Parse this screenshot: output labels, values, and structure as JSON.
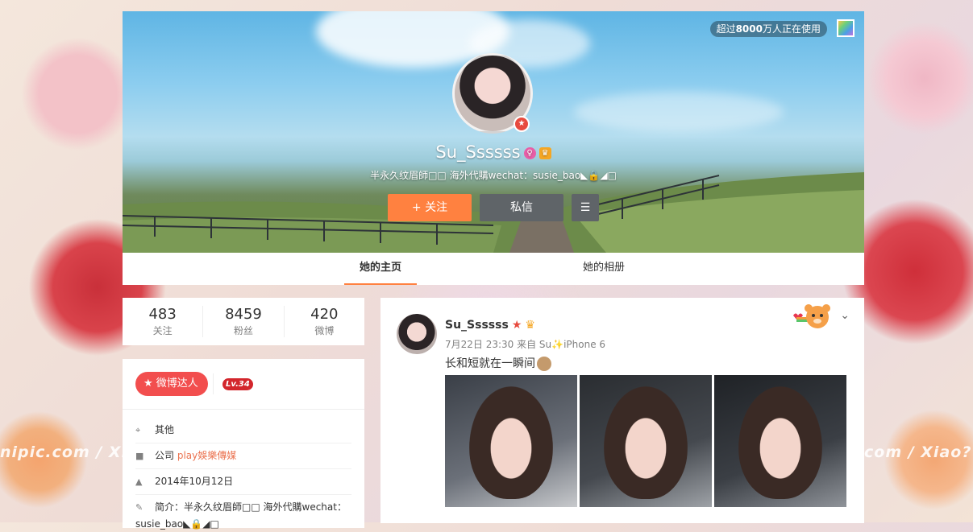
{
  "watermark": {
    "left": "nipic.com / Xiao",
    "right": "com / Xiao?"
  },
  "cover": {
    "usage_badge_prefix": "超过",
    "usage_badge_number": "8000",
    "usage_badge_suffix": "万人正在使用",
    "screen_name": "Su_Ssssss",
    "bio": "半永久纹眉師□□ 海外代購wechat：susie_bao◣🔒◢□",
    "follow_label": "+ 关注",
    "message_label": "私信",
    "more_icon": "menu-icon"
  },
  "tabs": {
    "home": "她的主页",
    "album": "她的相册"
  },
  "counts": [
    {
      "num": "483",
      "label": "关注"
    },
    {
      "num": "8459",
      "label": "粉丝"
    },
    {
      "num": "420",
      "label": "微博"
    }
  ],
  "info": {
    "talent_label": "微博达人",
    "level": "Lv.34",
    "location": "其他",
    "company_prefix": "公司",
    "company_name": "play娛樂傳媒",
    "date": "2014年10月12日",
    "intro_label": "简介：",
    "intro_text": "半永久纹眉師□□ 海外代購wechat：",
    "intro_text2": "susie_bao◣🔒◢□"
  },
  "feed": {
    "name": "Su_Ssssss",
    "meta": "7月22日 23:30 来自 Su✨iPhone 6",
    "text": "长和短就在一瞬间"
  },
  "colors": {
    "accent": "#ff8140",
    "dark_button": "#5f6468",
    "talent_red": "#f24e4e"
  }
}
